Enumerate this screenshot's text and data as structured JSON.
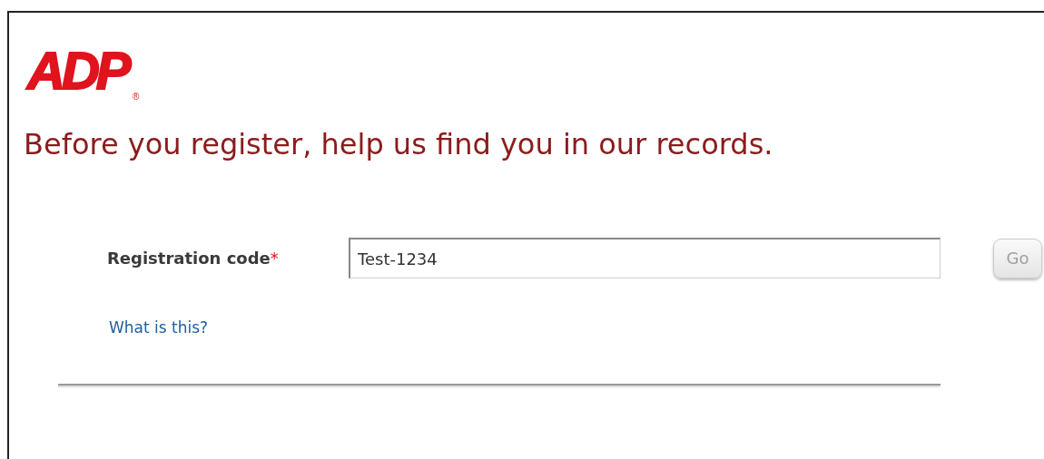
{
  "logo": {
    "text": "ADP",
    "mark": "®"
  },
  "heading": "Before you register, help us find you in our records.",
  "form": {
    "label": "Registration code",
    "required_mark": "*",
    "value": "Test-1234",
    "button": {
      "label": "Go",
      "disabled": true
    },
    "help_link": "What is this?"
  }
}
